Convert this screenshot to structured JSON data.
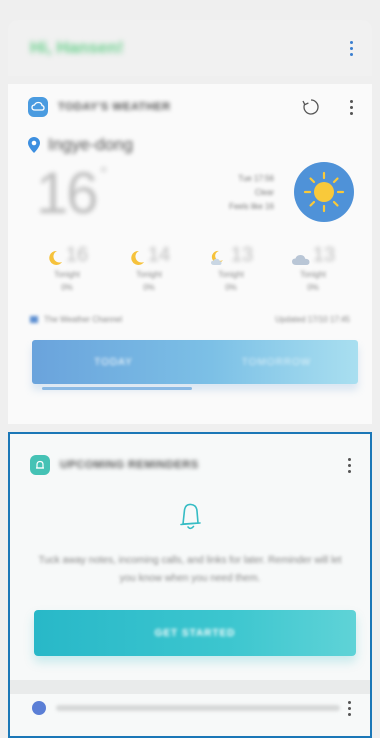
{
  "header": {
    "greeting": "Hi, Hansen!"
  },
  "weather": {
    "title": "TODAY'S WEATHER",
    "location": "Ingye-dong",
    "temperature": "16",
    "degree": "°",
    "conditions": [
      "Tue 17:56",
      "Clear",
      "Feels like 16"
    ],
    "forecast": [
      {
        "icon": "moon-icon",
        "temp": "16",
        "time": "Tonight",
        "precip": "0%"
      },
      {
        "icon": "moon-icon",
        "temp": "14",
        "time": "Tonight",
        "precip": "0%"
      },
      {
        "icon": "moon-partly-cloudy-icon",
        "temp": "13",
        "time": "Tonight",
        "precip": "0%"
      },
      {
        "icon": "cloud-icon",
        "temp": "13",
        "time": "Tonight",
        "precip": "0%"
      }
    ],
    "source": "The Weather Channel",
    "updated": "Updated 17/10 17:45",
    "tabs": [
      "TODAY",
      "TOMORROW"
    ]
  },
  "reminders": {
    "title": "UPCOMING REMINDERS",
    "description": "Tuck away notes, incoming calls, and links for later. Reminder will let you know when you need them.",
    "cta": "GET STARTED"
  },
  "colors": {
    "greeting": "#6ed08f",
    "weather_accent": "#4a9be0",
    "reminder_accent": "#45c2b5",
    "selection_border": "#1b77b7"
  }
}
